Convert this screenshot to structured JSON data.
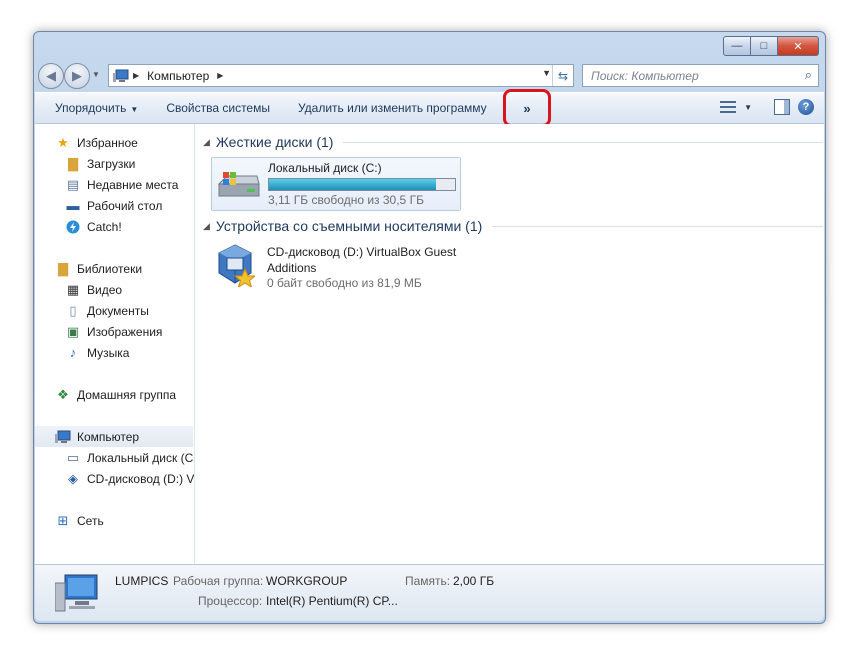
{
  "window": {
    "buttons": {
      "minimize": "—",
      "maximize": "□",
      "close": "✕"
    }
  },
  "navigation": {
    "back_icon": "back-arrow-icon",
    "forward_icon": "forward-arrow-icon",
    "address_path": "Компьютер",
    "search_placeholder": "Поиск: Компьютер"
  },
  "toolbar": {
    "organize": "Упорядочить",
    "system_properties": "Свойства системы",
    "uninstall": "Удалить или изменить программу",
    "more": "»"
  },
  "sidebar": {
    "favorites": "Избранное",
    "downloads": "Загрузки",
    "recent": "Недавние места",
    "desktop": "Рабочий стол",
    "catch": "Catch!",
    "libraries": "Библиотеки",
    "video": "Видео",
    "documents": "Документы",
    "images": "Изображения",
    "music": "Музыка",
    "homegroup": "Домашняя группа",
    "computer": "Компьютер",
    "local_disk": "Локальный диск (C",
    "cd_drive": "CD-дисковод (D:) Vi",
    "network": "Сеть"
  },
  "main": {
    "hdd_group": "Жесткие диски (1)",
    "removable_group": "Устройства со съемными носителями (1)",
    "drive_c": {
      "name": "Локальный диск (C:)",
      "free": "3,11 ГБ свободно из 30,5 ГБ",
      "used_fraction": 0.898
    },
    "drive_d": {
      "name": "CD-дисковод (D:) VirtualBox Guest Additions",
      "free": "0 байт свободно из 81,9 МБ"
    }
  },
  "status": {
    "computer_name": "LUMPICS",
    "workgroup_label": "Рабочая группа:",
    "workgroup_value": "WORKGROUP",
    "memory_label": "Память:",
    "memory_value": "2,00 ГБ",
    "cpu_label": "Процессор:",
    "cpu_value": "Intel(R) Pentium(R) CP..."
  },
  "colors": {
    "highlight": "#d9141c",
    "accent": "#1e395b"
  }
}
